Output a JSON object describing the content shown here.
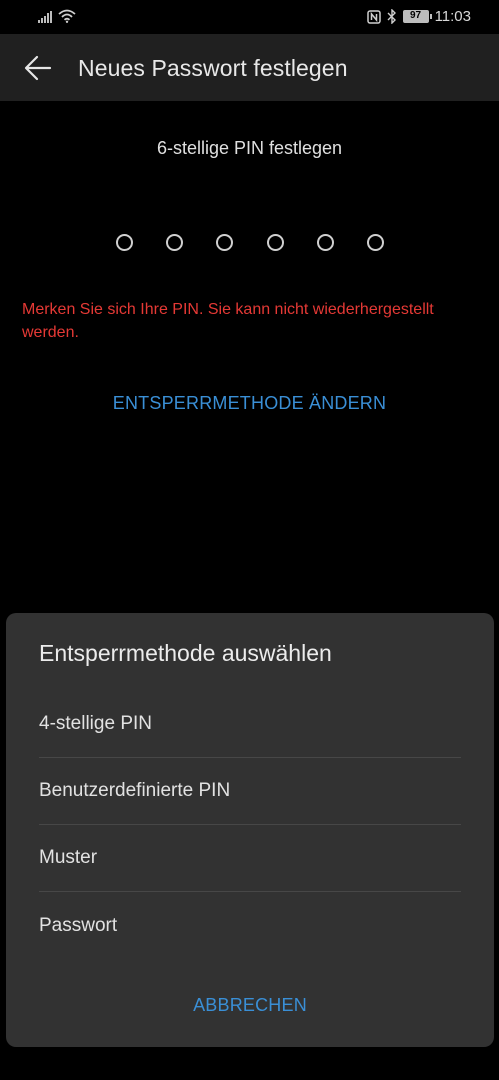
{
  "status_bar": {
    "time": "11:03",
    "battery": "97",
    "icons": [
      "signal-icon",
      "wifi-icon",
      "nfc-icon",
      "bluetooth-icon",
      "battery-icon"
    ]
  },
  "app_bar": {
    "title": "Neues Passwort festlegen",
    "back_icon": "arrow-left-icon"
  },
  "pin_entry": {
    "title": "6-stellige PIN festlegen",
    "digits_entered": 0,
    "digits_total": 6,
    "warning": "Merken Sie sich Ihre PIN. Sie kann nicht wiederhergestellt werden.",
    "change_method_label": "ENTSPERRMETHODE ÄNDERN"
  },
  "sheet": {
    "title": "Entsperrmethode auswählen",
    "items": [
      {
        "label": "4-stellige PIN"
      },
      {
        "label": "Benutzerdefinierte PIN"
      },
      {
        "label": "Muster"
      },
      {
        "label": "Passwort"
      }
    ],
    "cancel_label": "ABBRECHEN"
  },
  "colors": {
    "background": "#000000",
    "app_bar": "#202020",
    "sheet": "#323232",
    "accent": "#3a8fd6",
    "warning": "#e53935"
  }
}
